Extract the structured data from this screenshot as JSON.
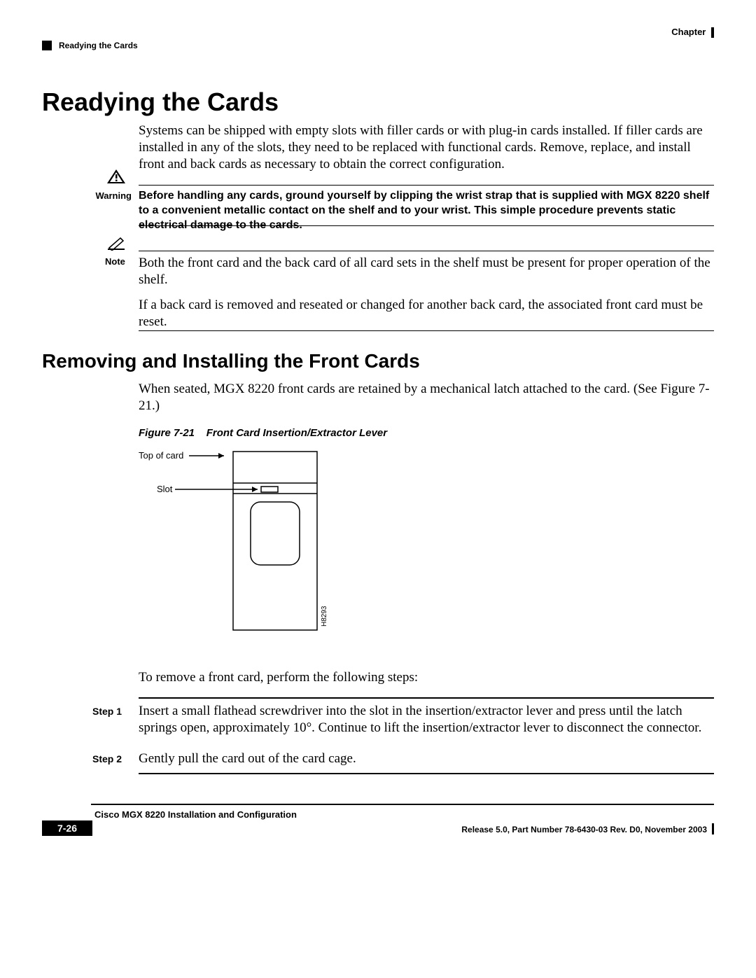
{
  "header": {
    "chapter": "Chapter",
    "section": "Readying the Cards"
  },
  "h1": "Readying the Cards",
  "intro": "Systems can be shipped with empty slots with filler cards or with plug-in cards installed. If filler cards are installed in any of the slots, they need to be replaced with functional cards. Remove, replace, and install front and back cards as necessary to obtain the correct configuration.",
  "warning": {
    "label": "Warning",
    "text": "Before handling any cards, ground yourself by clipping the wrist strap that is supplied with MGX 8220 shelf to a convenient metallic contact on the shelf and to your wrist. This simple procedure prevents static electrical damage to the cards."
  },
  "note": {
    "label": "Note",
    "p1": "Both the front card and the back card of all card sets in the shelf must be present for proper operation of the shelf.",
    "p2": "If a back card is removed and reseated or changed for another back card, the associated front card must be reset."
  },
  "h2": "Removing and Installing the Front Cards",
  "p_sub": "When seated, MGX 8220 front cards are retained by a mechanical latch attached to the card. (See Figure 7-21.)",
  "figure": {
    "label": "Figure 7-21",
    "title": "Front Card Insertion/Extractor Lever",
    "top_of_card": "Top of card",
    "slot": "Slot",
    "id": "H8293"
  },
  "remove_intro": "To remove a front card, perform the following steps:",
  "steps": {
    "s1_label": "Step 1",
    "s1_text": "Insert a small flathead screwdriver into the slot in the insertion/extractor lever and press until the latch springs open, approximately 10°. Continue to lift the insertion/extractor lever to disconnect the connector.",
    "s2_label": "Step 2",
    "s2_text": "Gently pull the card out of the card cage."
  },
  "footer": {
    "doc": "Cisco MGX 8220 Installation and Configuration",
    "page": "7-26",
    "release": "Release 5.0, Part Number 78-6430-03 Rev. D0, November 2003"
  }
}
